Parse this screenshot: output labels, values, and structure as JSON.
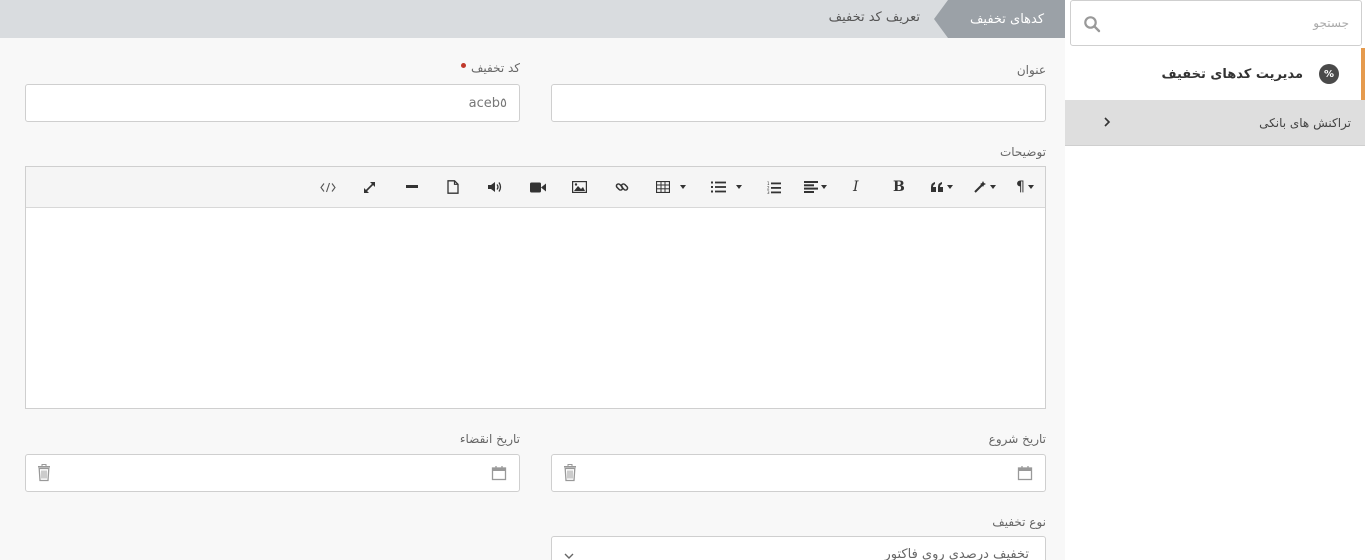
{
  "sidebar": {
    "search_placeholder": "جستجو",
    "active_item": {
      "label": "مدیریت کدهای تخفیف",
      "icon": "percent-icon"
    },
    "items": [
      {
        "label": "تراکنش های بانکی",
        "icon": "chevron-right-icon"
      }
    ],
    "accent_color": "#e59a4d"
  },
  "breadcrumb": {
    "current": "کدهای تخفیف",
    "previous": "تعریف کد تخفیف"
  },
  "form": {
    "title_label": "عنوان",
    "title_value": "",
    "code_label": "کد تخفیف",
    "code_value": "aceb٥",
    "description_label": "توضیحات",
    "start_date_label": "تاریخ شروع",
    "end_date_label": "تاریخ انقضاء",
    "discount_type_label": "نوع تخفیف",
    "discount_type_value": "تخفیف درصدی روی فاکتور"
  },
  "editor_toolbar": {
    "tools": [
      "paragraph-icon",
      "magic-icon",
      "quote-icon",
      "bold-icon",
      "italic-icon",
      "align-icon",
      "ordered-list-icon",
      "unordered-list-icon",
      "table-icon",
      "link-icon",
      "image-icon",
      "video-icon",
      "audio-icon",
      "file-icon",
      "horizontal-rule-icon",
      "fullscreen-icon",
      "code-view-icon"
    ]
  }
}
